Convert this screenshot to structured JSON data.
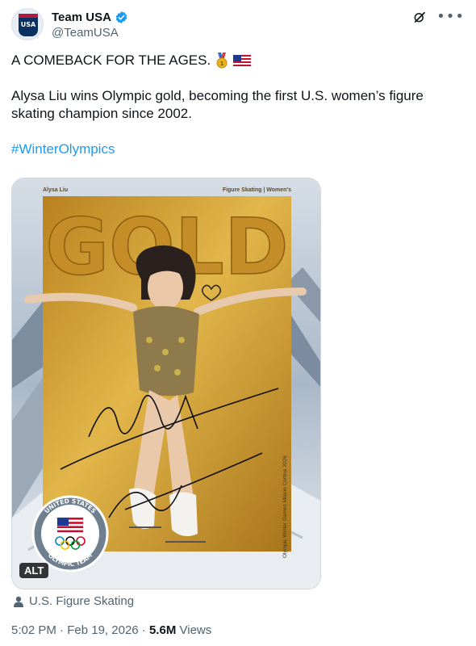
{
  "author": {
    "display_name": "Team USA",
    "handle": "@TeamUSA",
    "avatar_text": "USA"
  },
  "tweet": {
    "line1": "A COMEBACK FOR THE AGES.",
    "line2": "Alysa Liu wins Olympic gold, becoming the first U.S. women’s figure skating champion since 2002.",
    "hashtag": "#WinterOlympics",
    "emojis": [
      "gold-medal-emoji",
      "us-flag-emoji"
    ]
  },
  "media": {
    "corner_left": "Alysa Liu",
    "corner_right": "Figure Skating | Women's",
    "headline": "GOLD",
    "side_text": "Olympic Winter Games Milano Cortina 2026",
    "seal_top": "UNITED STATES",
    "seal_bottom": "OLYMPIC TEAM",
    "alt_label": "ALT",
    "colors": {
      "gold": "#c99a2e",
      "sky": "#b9c7d6"
    }
  },
  "tagged": {
    "icon": "person-icon",
    "label": "U.S. Figure Skating"
  },
  "meta": {
    "time": "5:02 PM",
    "date": "Feb 19, 2026",
    "separator": "·",
    "views_count": "5.6M",
    "views_label": "Views"
  },
  "colors": {
    "link": "#1d9bf0",
    "secondary": "#536471",
    "verified": "#1d9bf0"
  }
}
